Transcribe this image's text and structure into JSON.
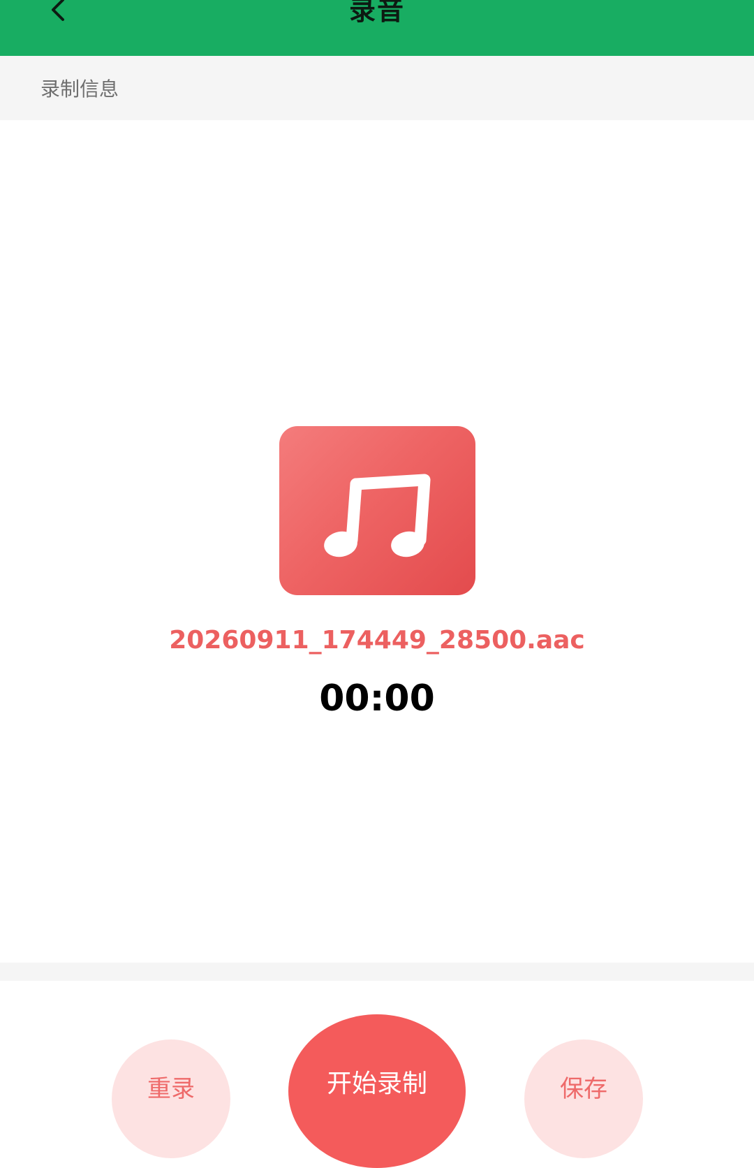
{
  "header": {
    "title": "录音",
    "back_icon": "chevron-left-icon",
    "background_color": "#18AD62"
  },
  "info_bar": {
    "label": "录制信息"
  },
  "recording": {
    "icon": "music-note-icon",
    "filename": "20260911_174449_28500.aac",
    "elapsed": "00:00"
  },
  "controls": {
    "rerecord_label": "重录",
    "start_label": "开始录制",
    "save_label": "保存"
  },
  "colors": {
    "accent": "#F45B5B",
    "soft_accent": "#FDE2E2",
    "filename_text": "#EC6060"
  }
}
